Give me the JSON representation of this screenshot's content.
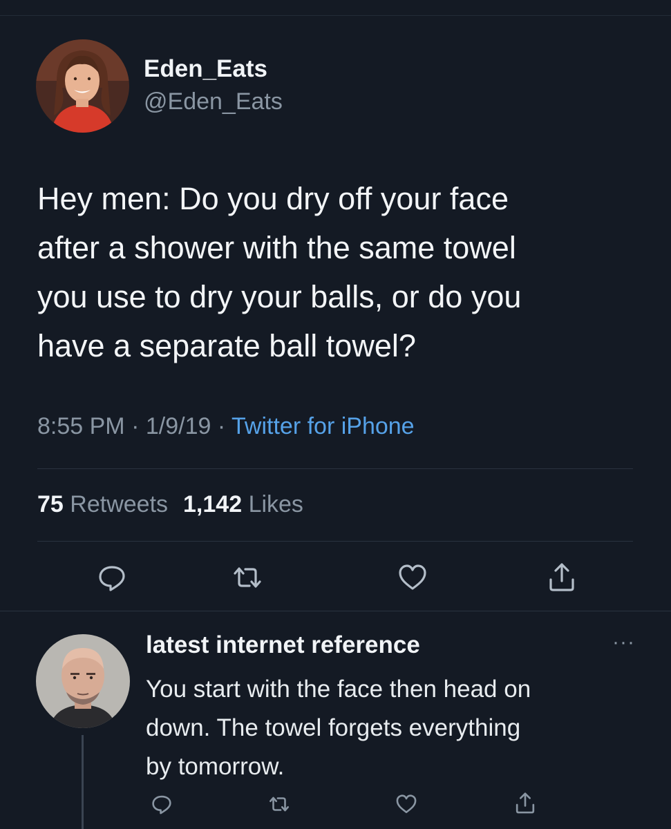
{
  "tweet": {
    "display_name": "Eden_Eats",
    "handle": "@Eden_Eats",
    "text_lines": [
      "Hey men: Do you dry off your face",
      "after a shower with the same towel",
      "you use to dry your balls, or do you",
      "have a separate ball towel?"
    ],
    "time": "8:55 PM",
    "date": "1/9/19",
    "separator": "·",
    "source": "Twitter for iPhone",
    "retweet_count": "75",
    "retweet_label": "Retweets",
    "like_count": "1,142",
    "like_label": "Likes",
    "actions": [
      "reply-icon",
      "retweet-icon",
      "like-icon",
      "share-icon"
    ]
  },
  "reply": {
    "display_name": "latest internet reference",
    "more_label": "···",
    "text_lines": [
      "You start with the face then head on",
      "down. The towel forgets everything",
      "by tomorrow."
    ],
    "actions": [
      "reply-icon",
      "retweet-icon",
      "like-icon",
      "share-icon"
    ]
  },
  "colors": {
    "background": "#141a24",
    "primary_text": "#f1f4f7",
    "secondary_text": "#8a96a3",
    "link": "#56a2e8",
    "divider": "#2a3340"
  }
}
